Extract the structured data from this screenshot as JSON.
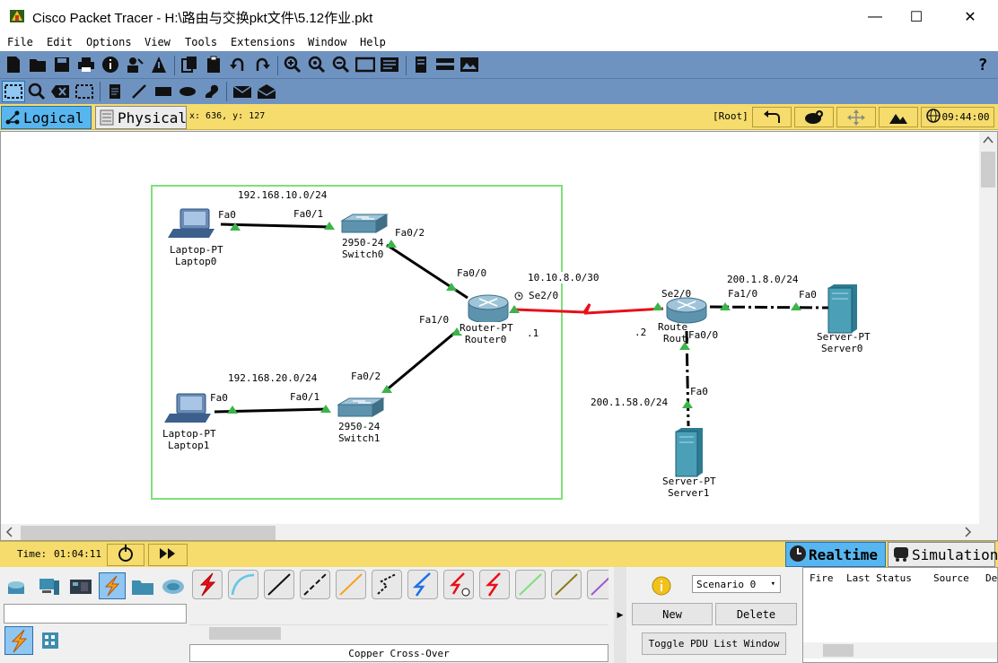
{
  "window": {
    "title": "Cisco Packet Tracer - H:\\路由与交换pkt文件\\5.12作业.pkt",
    "minimize_glyph": "—",
    "maximize_glyph": "☐",
    "close_glyph": "✕"
  },
  "menu": [
    "File",
    "Edit",
    "Options",
    "View",
    "Tools",
    "Extensions",
    "Window",
    "Help"
  ],
  "toolbar": {
    "icons": [
      "new-file-icon",
      "open-folder-icon",
      "save-icon",
      "print-icon",
      "info-icon",
      "activity-wizard-icon",
      "network-info-icon",
      "copy-icon",
      "paste-icon",
      "undo-icon",
      "redo-icon",
      "zoom-in-icon",
      "zoom-reset-icon",
      "zoom-out-icon",
      "drawing-palette-icon",
      "custom-device-icon",
      "server-icon",
      "pdu-icon",
      "image-icon"
    ],
    "help_glyph": "?"
  },
  "toolbar2": {
    "icons": [
      "select-icon",
      "inspect-icon",
      "delete-icon",
      "resize-icon",
      "note-icon",
      "line-icon",
      "rectangle-icon",
      "ellipse-icon",
      "freeform-icon",
      "simple-pdu-icon",
      "complex-pdu-icon"
    ]
  },
  "logical_bar": {
    "logical_label": "Logical",
    "physical_label": "Physical",
    "coords": "x: 636, y: 127",
    "root_label": "[Root]",
    "clock": "09:44:00"
  },
  "network": {
    "lan1": "192.168.10.0/24",
    "lan2": "192.168.20.0/24",
    "wan": "10.10.8.0/30",
    "server_net1": "200.1.8.0/24",
    "server_net2": "200.1.58.0/24",
    "wan_r0_ip": ".1",
    "wan_r1_ip": ".2",
    "devices": {
      "laptop0": {
        "model": "Laptop-PT",
        "name": "Laptop0"
      },
      "laptop1": {
        "model": "Laptop-PT",
        "name": "Laptop1"
      },
      "switch0": {
        "model": "2950-24",
        "name": "Switch0"
      },
      "switch1": {
        "model": "2950-24",
        "name": "Switch1"
      },
      "router0": {
        "model": "Router-PT",
        "name": "Router0"
      },
      "router1": {
        "model": "Router-PT",
        "name": "Router1"
      },
      "server0": {
        "model": "Server-PT",
        "name": "Server0"
      },
      "server1": {
        "model": "Server-PT",
        "name": "Server1"
      }
    },
    "ports": {
      "l0_fa0": "Fa0",
      "s0_fa01": "Fa0/1",
      "s0_fa02": "Fa0/2",
      "r0_fa00": "Fa0/0",
      "r0_fa10": "Fa1/0",
      "r0_se20": "Se2/0",
      "l1_fa0": "Fa0",
      "s1_fa01": "Fa0/1",
      "s1_fa02": "Fa0/2",
      "r1_se20": "Se2/0",
      "r1_fa10": "Fa1/0",
      "r1_fa00": "Fa0/0",
      "srv0_fa0": "Fa0",
      "srv1_fa0": "Fa0"
    },
    "colors": {
      "serial_link": "#e8101a",
      "ethernet_link": "#000000",
      "link_up": "#3bb54a",
      "area_box": "#7ee07a"
    }
  },
  "timebar": {
    "time_label": "Time:",
    "time_value": "01:04:11",
    "realtime_label": "Realtime",
    "simulation_label": "Simulation"
  },
  "bottom": {
    "device_categories": [
      "network-devices-icon",
      "end-devices-icon",
      "components-icon",
      "connections-icon",
      "misc-icon",
      "multiuser-icon"
    ],
    "connection_types": [
      "automatic-icon",
      "console-icon",
      "copper-straight-icon",
      "copper-cross-icon",
      "fiber-icon",
      "phone-icon",
      "coaxial-icon",
      "serial-dce-icon",
      "serial-dte-icon",
      "octal-icon",
      "iot-icon",
      "usb-icon"
    ],
    "selected_connection": "Copper Cross-Over",
    "scenario": "Scenario 0",
    "new_label": "New",
    "delete_label": "Delete",
    "toggle_label": "Toggle PDU List Window",
    "pdu_columns": [
      "Fire",
      "Last Status",
      "Source",
      "De"
    ]
  }
}
